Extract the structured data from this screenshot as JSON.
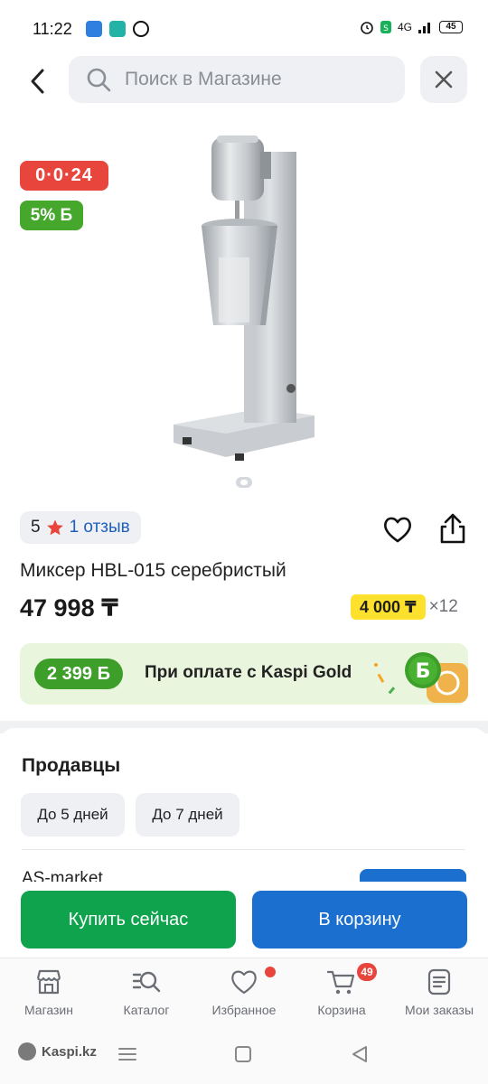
{
  "status_bar": {
    "time": "11:22",
    "network": "4G",
    "battery": "45",
    "icons": [
      "wifi-like-app-icon",
      "chat-app-icon",
      "whatsapp-icon",
      "alarm-icon",
      "sim-icon",
      "signal-icon",
      "battery-icon"
    ]
  },
  "search": {
    "placeholder": "Поиск в Магазине"
  },
  "product": {
    "timer": "0·0·24",
    "bonus_badge": "5% Б",
    "rating_value": "5",
    "reviews_label": "1 отзыв",
    "title": "Миксер HBL-015 серебристый",
    "price": "47 998 ₸",
    "installment_amount": "4 000 ₸",
    "installment_months": "×12",
    "image_count": 1
  },
  "gold_offer": {
    "amount": "2 399 Б",
    "text": "При оплате с Kaspi Gold"
  },
  "sellers": {
    "title": "Продавцы",
    "delivery_filters": [
      "До 5 дней",
      "До 7 дней"
    ],
    "first_seller": "AS-market"
  },
  "actions": {
    "buy_now": "Купить сейчас",
    "add_to_cart": "В корзину"
  },
  "bottom_nav": {
    "items": [
      {
        "label": "Магазин",
        "icon": "store-icon"
      },
      {
        "label": "Каталог",
        "icon": "catalog-search-icon"
      },
      {
        "label": "Избранное",
        "icon": "heart-icon"
      },
      {
        "label": "Корзина",
        "icon": "cart-icon"
      },
      {
        "label": "Мои заказы",
        "icon": "orders-icon"
      }
    ],
    "cart_count": "49"
  },
  "system_nav": {
    "brand": "Kaspi.kz"
  },
  "colors": {
    "primary_blue": "#1a6fcf",
    "buy_green": "#10a34e",
    "timer_red": "#e8453c",
    "bonus_green": "#45a72b",
    "installment_yellow": "#fde12d"
  }
}
